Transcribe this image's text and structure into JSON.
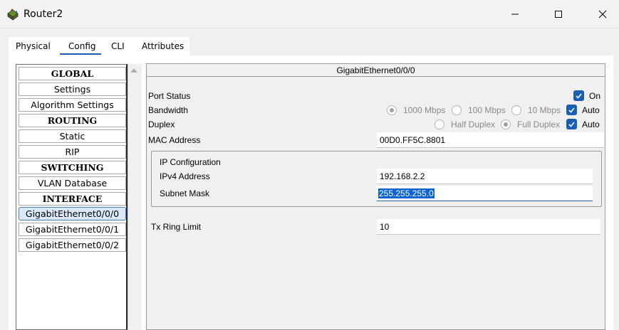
{
  "window": {
    "title": "Router2",
    "icon": "router-app-icon",
    "controls": [
      "minimize-icon",
      "maximize-icon",
      "close-icon"
    ]
  },
  "tabs": [
    {
      "label": "Physical"
    },
    {
      "label": "Config",
      "active": true
    },
    {
      "label": "CLI"
    },
    {
      "label": "Attributes"
    }
  ],
  "nav": {
    "global": "GLOBAL",
    "settings": "Settings",
    "algorithm_settings": "Algorithm Settings",
    "routing": "ROUTING",
    "static": "Static",
    "rip": "RIP",
    "switching": "SWITCHING",
    "vlan_database": "VLAN Database",
    "interface": "INTERFACE",
    "gi0": "GigabitEthernet0/0/0",
    "gi1": "GigabitEthernet0/0/1",
    "gi2": "GigabitEthernet0/0/2"
  },
  "panel": {
    "title": "GigabitEthernet0/0/0",
    "port_status": {
      "label": "Port Status",
      "on_label": "On",
      "checked": true
    },
    "bandwidth": {
      "label": "Bandwidth",
      "options": [
        "1000 Mbps",
        "100 Mbps",
        "10 Mbps"
      ],
      "selected": "1000 Mbps",
      "auto_label": "Auto",
      "auto_checked": true
    },
    "duplex": {
      "label": "Duplex",
      "options": [
        "Half Duplex",
        "Full Duplex"
      ],
      "selected": "Full Duplex",
      "auto_label": "Auto",
      "auto_checked": true
    },
    "mac": {
      "label": "MAC Address",
      "value": "00D0.FF5C.8801"
    },
    "ip_config": {
      "title": "IP Configuration",
      "ipv4_label": "IPv4 Address",
      "ipv4_value": "192.168.2.2",
      "mask_label": "Subnet Mask",
      "mask_value": "255.255.255.0"
    },
    "tx_ring": {
      "label": "Tx Ring Limit",
      "value": "10"
    }
  },
  "colors": {
    "accent": "#1a5fb4",
    "selection": "#0a64d0",
    "window_bg": "#f0f0f0"
  }
}
